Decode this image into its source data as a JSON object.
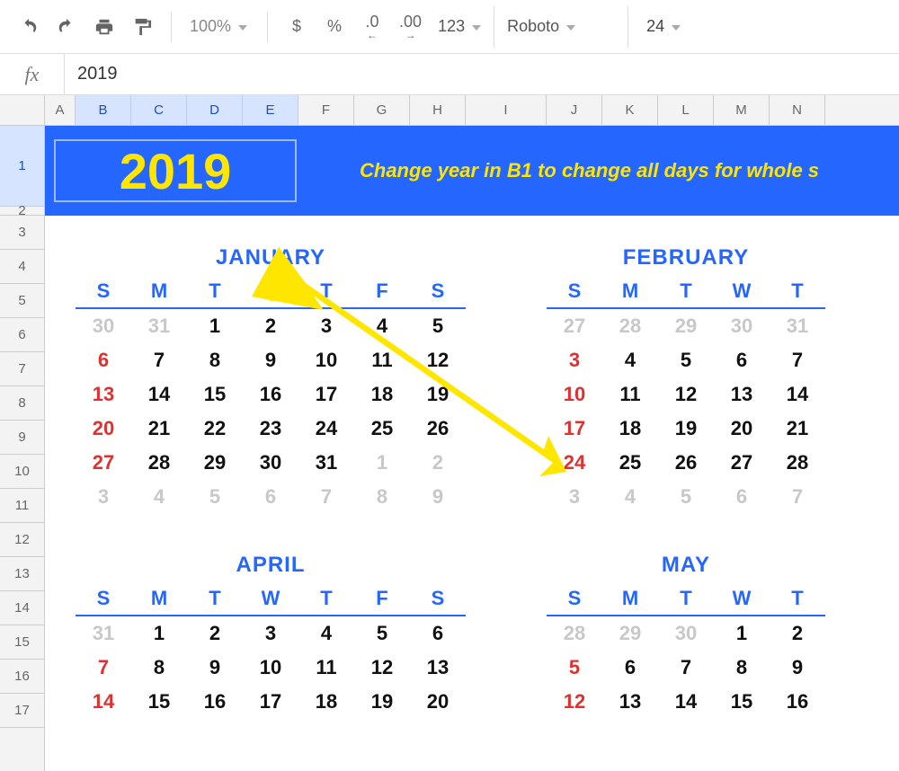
{
  "toolbar": {
    "zoom": "100%",
    "currency": "$",
    "percent": "%",
    "dec_less": ".0",
    "dec_more": ".00",
    "numfmt": "123",
    "font": "Roboto",
    "size": "24"
  },
  "formula_bar": {
    "fx": "fx",
    "value": "2019"
  },
  "columns": [
    "A",
    "B",
    "C",
    "D",
    "E",
    "F",
    "G",
    "H",
    "I",
    "J",
    "K",
    "L",
    "M",
    "N"
  ],
  "selected_cols": [
    "B",
    "C",
    "D",
    "E"
  ],
  "rows": [
    "1",
    "2",
    "3",
    "4",
    "5",
    "6",
    "7",
    "8",
    "9",
    "10",
    "11",
    "12",
    "13",
    "14",
    "15",
    "16",
    "17"
  ],
  "selected_row": "1",
  "banner": {
    "year": "2019",
    "note": "Change year in B1 to change all days for whole s"
  },
  "dayletters": [
    "S",
    "M",
    "T",
    "W",
    "T",
    "F",
    "S"
  ],
  "dayletters5": [
    "S",
    "M",
    "T",
    "W",
    "T"
  ],
  "months_top": [
    {
      "name": "JANUARY",
      "cols": 7,
      "weeks": [
        [
          {
            "n": "30",
            "c": "off"
          },
          {
            "n": "31",
            "c": "off"
          },
          {
            "n": "1"
          },
          {
            "n": "2"
          },
          {
            "n": "3"
          },
          {
            "n": "4"
          },
          {
            "n": "5"
          }
        ],
        [
          {
            "n": "6",
            "c": "sun"
          },
          {
            "n": "7"
          },
          {
            "n": "8"
          },
          {
            "n": "9"
          },
          {
            "n": "10"
          },
          {
            "n": "11"
          },
          {
            "n": "12"
          }
        ],
        [
          {
            "n": "13",
            "c": "sun"
          },
          {
            "n": "14"
          },
          {
            "n": "15"
          },
          {
            "n": "16"
          },
          {
            "n": "17"
          },
          {
            "n": "18"
          },
          {
            "n": "19"
          }
        ],
        [
          {
            "n": "20",
            "c": "sun"
          },
          {
            "n": "21"
          },
          {
            "n": "22"
          },
          {
            "n": "23"
          },
          {
            "n": "24"
          },
          {
            "n": "25"
          },
          {
            "n": "26"
          }
        ],
        [
          {
            "n": "27",
            "c": "sun"
          },
          {
            "n": "28"
          },
          {
            "n": "29"
          },
          {
            "n": "30"
          },
          {
            "n": "31"
          },
          {
            "n": "1",
            "c": "off"
          },
          {
            "n": "2",
            "c": "off"
          }
        ],
        [
          {
            "n": "3",
            "c": "off"
          },
          {
            "n": "4",
            "c": "off"
          },
          {
            "n": "5",
            "c": "off"
          },
          {
            "n": "6",
            "c": "off"
          },
          {
            "n": "7",
            "c": "off"
          },
          {
            "n": "8",
            "c": "off"
          },
          {
            "n": "9",
            "c": "off"
          }
        ]
      ]
    },
    {
      "name": "FEBRUARY",
      "cols": 5,
      "weeks": [
        [
          {
            "n": "27",
            "c": "off"
          },
          {
            "n": "28",
            "c": "off"
          },
          {
            "n": "29",
            "c": "off"
          },
          {
            "n": "30",
            "c": "off"
          },
          {
            "n": "31",
            "c": "off"
          }
        ],
        [
          {
            "n": "3",
            "c": "sun"
          },
          {
            "n": "4"
          },
          {
            "n": "5"
          },
          {
            "n": "6"
          },
          {
            "n": "7"
          }
        ],
        [
          {
            "n": "10",
            "c": "sun"
          },
          {
            "n": "11"
          },
          {
            "n": "12"
          },
          {
            "n": "13"
          },
          {
            "n": "14"
          }
        ],
        [
          {
            "n": "17",
            "c": "sun"
          },
          {
            "n": "18"
          },
          {
            "n": "19"
          },
          {
            "n": "20"
          },
          {
            "n": "21"
          }
        ],
        [
          {
            "n": "24",
            "c": "sun"
          },
          {
            "n": "25"
          },
          {
            "n": "26"
          },
          {
            "n": "27"
          },
          {
            "n": "28"
          }
        ],
        [
          {
            "n": "3",
            "c": "off"
          },
          {
            "n": "4",
            "c": "off"
          },
          {
            "n": "5",
            "c": "off"
          },
          {
            "n": "6",
            "c": "off"
          },
          {
            "n": "7",
            "c": "off"
          }
        ]
      ]
    }
  ],
  "months_bottom": [
    {
      "name": "APRIL",
      "cols": 7,
      "weeks": [
        [
          {
            "n": "31",
            "c": "off"
          },
          {
            "n": "1"
          },
          {
            "n": "2"
          },
          {
            "n": "3"
          },
          {
            "n": "4"
          },
          {
            "n": "5"
          },
          {
            "n": "6"
          }
        ],
        [
          {
            "n": "7",
            "c": "sun"
          },
          {
            "n": "8"
          },
          {
            "n": "9"
          },
          {
            "n": "10"
          },
          {
            "n": "11"
          },
          {
            "n": "12"
          },
          {
            "n": "13"
          }
        ],
        [
          {
            "n": "14",
            "c": "sun"
          },
          {
            "n": "15"
          },
          {
            "n": "16"
          },
          {
            "n": "17"
          },
          {
            "n": "18"
          },
          {
            "n": "19"
          },
          {
            "n": "20"
          }
        ]
      ]
    },
    {
      "name": "MAY",
      "cols": 5,
      "weeks": [
        [
          {
            "n": "28",
            "c": "off"
          },
          {
            "n": "29",
            "c": "off"
          },
          {
            "n": "30",
            "c": "off"
          },
          {
            "n": "1"
          },
          {
            "n": "2"
          }
        ],
        [
          {
            "n": "5",
            "c": "sun"
          },
          {
            "n": "6"
          },
          {
            "n": "7"
          },
          {
            "n": "8"
          },
          {
            "n": "9"
          }
        ],
        [
          {
            "n": "12",
            "c": "sun"
          },
          {
            "n": "13"
          },
          {
            "n": "14"
          },
          {
            "n": "15"
          },
          {
            "n": "16"
          }
        ]
      ]
    }
  ]
}
